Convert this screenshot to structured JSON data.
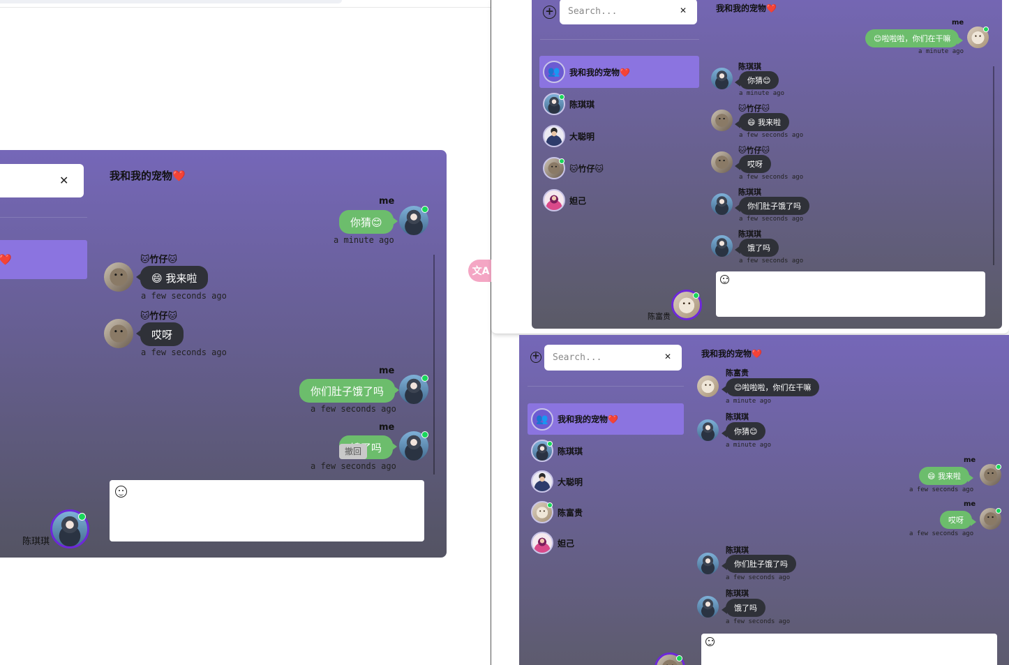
{
  "search_placeholder": "Search...",
  "close_glyph": "✕",
  "group_name": "我和我的宠物❤️",
  "contacts": {
    "group": "我和我的宠物❤️",
    "chenqiqi": "陈琪琪",
    "dacongming": "大聪明",
    "zhuzai": "🐱竹仔🐱",
    "chenfugui": "陈富贵",
    "daji": "妲己"
  },
  "senders": {
    "me": "me",
    "zhuzai": "🐱竹仔🐱",
    "chenqiqi": "陈琪琪",
    "chenfugui": "陈富贵"
  },
  "messages": {
    "lalala": "😊啦啦啦，你们在干嘛",
    "guess": "你猜😊",
    "here": "😄 我来啦",
    "aiya": "哎呀",
    "hungry_q": "你们肚子饿了吗",
    "hungry_short": "饿了吗"
  },
  "times": {
    "minute": "a minute ago",
    "seconds": "a few seconds ago"
  },
  "window1": {
    "self_name": "陈琪琪",
    "withdraw_label": "撤回"
  },
  "window2": {
    "self_name": "陈富贵"
  },
  "translate_label": "文A",
  "colors": {
    "panel_top": "#7567b8",
    "panel_bottom": "#545463",
    "active_contact": "#8b74e0",
    "bubble_dark": "#2f3138",
    "bubble_green": "#6cbd6c",
    "online_dot": "#19d65a"
  },
  "icons": {
    "plus": "plus-circle-icon",
    "close": "close-icon",
    "group": "group-icon",
    "emoji": "smiley-icon",
    "translate": "translate-icon"
  }
}
